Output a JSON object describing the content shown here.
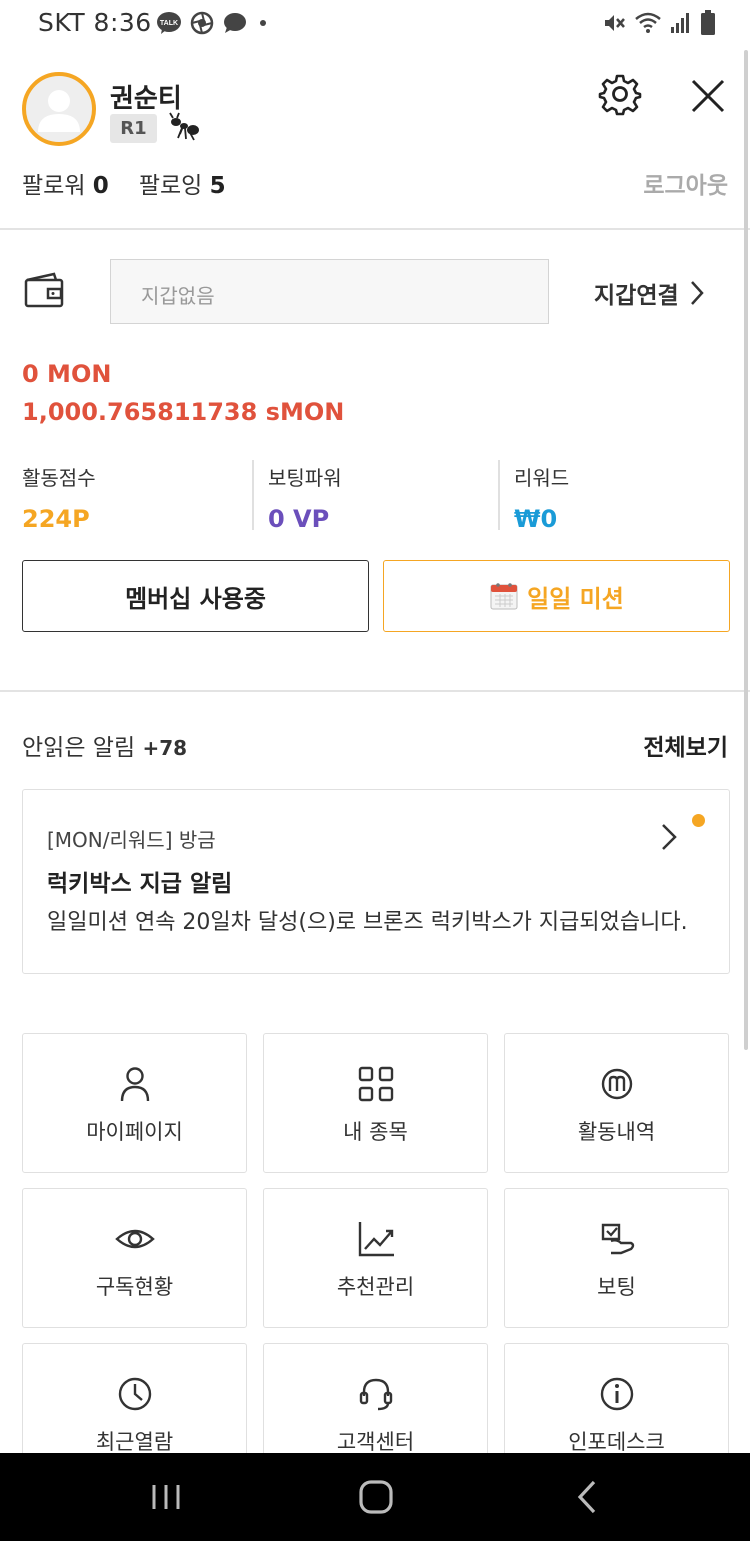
{
  "status_bar": {
    "carrier_time": "SKT 8:36",
    "kakao_badge": "TALK",
    "icons": [
      "kakaotalk-icon",
      "aperture-icon",
      "chat-bubble-icon",
      "dot-icon",
      "mute-icon",
      "wifi-icon",
      "signal-icon",
      "battery-icon"
    ]
  },
  "profile": {
    "name": "권순티",
    "rank": "R1",
    "followers_label": "팔로워",
    "followers_count": "0",
    "following_label": "팔로잉",
    "following_count": "5",
    "logout_label": "로그아웃"
  },
  "wallet": {
    "placeholder": "지갑없음",
    "connect_label": "지갑연결",
    "mon": "0 MON",
    "smon": "1,000.765811738 sMON"
  },
  "stats": [
    {
      "label": "활동점수",
      "value": "224P",
      "color": "#f5a623"
    },
    {
      "label": "보팅파워",
      "value": "0 VP",
      "color": "#6b4fbb"
    },
    {
      "label": "리워드",
      "value": "₩0",
      "color": "#1a9bd7"
    }
  ],
  "buttons": {
    "membership": "멤버십 사용중",
    "daily_mission": "일일 미션"
  },
  "notifications": {
    "unread_label": "안읽은 알림",
    "unread_count": "+78",
    "view_all": "전체보기",
    "item": {
      "meta": "[MON/리워드] 방금",
      "title": "럭키박스 지급 알림",
      "body": "일일미션 연속 20일차 달성(으)로 브론즈 럭키박스가 지급되었습니다."
    }
  },
  "menu": [
    {
      "label": "마이페이지",
      "icon": "person-icon"
    },
    {
      "label": "내 종목",
      "icon": "grid-icon"
    },
    {
      "label": "활동내역",
      "icon": "m-coin-icon"
    },
    {
      "label": "구독현황",
      "icon": "eye-icon"
    },
    {
      "label": "추천관리",
      "icon": "chart-trend-icon"
    },
    {
      "label": "보팅",
      "icon": "vote-hand-icon"
    },
    {
      "label": "최근열람",
      "icon": "clock-icon"
    },
    {
      "label": "고객센터",
      "icon": "headset-icon"
    },
    {
      "label": "인포데스크",
      "icon": "info-icon"
    }
  ],
  "colors": {
    "accent": "#f5a623",
    "mon_red": "#e0523c",
    "vp_purple": "#6b4fbb",
    "reward_blue": "#1a9bd7"
  }
}
